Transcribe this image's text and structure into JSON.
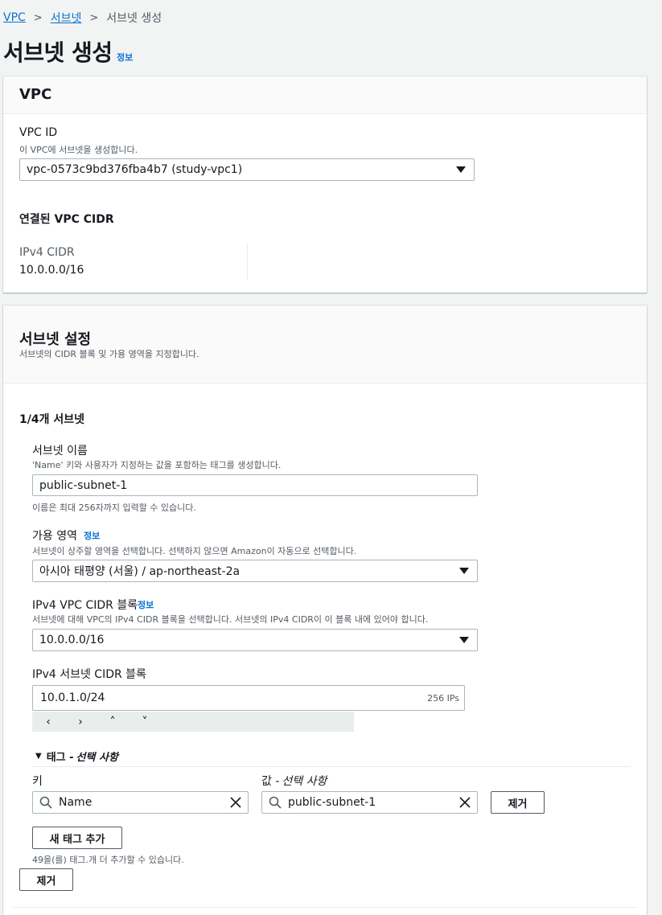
{
  "breadcrumb": {
    "vpc": "VPC",
    "subnet": "서브넷",
    "current": "서브넷 생성"
  },
  "page": {
    "title": "서브넷 생성",
    "info": "정보"
  },
  "vpc_panel": {
    "heading": "VPC",
    "vpc_id_label": "VPC ID",
    "vpc_id_desc": "이 VPC에 서브넷을 생성합니다.",
    "vpc_id_value": "vpc-0573c9bd376fba4b7 (study-vpc1)",
    "cidr_heading": "연결된 VPC CIDR",
    "ipv4_cidr_label": "IPv4 CIDR",
    "ipv4_cidr_value": "10.0.0.0/16"
  },
  "subnet_panel": {
    "heading": "서브넷 설정",
    "desc": "서브넷의 CIDR 블록 및 가용 영역을 지정합니다.",
    "count": "1/4개 서브넷",
    "name_label": "서브넷 이름",
    "name_desc": "'Name' 키와 사용자가 지정하는 값을 포함하는 태그를 생성합니다.",
    "name_value": "public-subnet-1",
    "name_hint": "이름은 최대 256자까지 입력할 수 있습니다.",
    "az_label": "가용 영역",
    "az_info": "정보",
    "az_desc": "서브넷이 상주할 영역을 선택합니다. 선택하지 않으면 Amazon이 자동으로 선택합니다.",
    "az_value": "아시아 태평양 (서울) / ap-northeast-2a",
    "vpc_cidr_label": "IPv4 VPC CIDR 블록",
    "vpc_cidr_info": "정보",
    "vpc_cidr_desc": "서브넷에 대해 VPC의 IPv4 CIDR 블록을 선택합니다. 서브넷의 IPv4 CIDR이 이 블록 내에 있어야 합니다.",
    "vpc_cidr_value": "10.0.0.0/16",
    "subnet_cidr_label": "IPv4 서브넷 CIDR 블록",
    "subnet_cidr_value": "10.0.1.0/24",
    "subnet_cidr_ips": "256 IPs",
    "nav_arrows": [
      "‹",
      "›",
      "˄",
      "˅"
    ],
    "tags_toggle": "태그 - ",
    "tags_toggle_optional": "선택 사항",
    "key_label": "키",
    "value_label": "값 - ",
    "value_label_optional": "선택 사항",
    "tag_key": "Name",
    "tag_value": "public-subnet-1",
    "remove_tag": "제거",
    "add_tag": "새 태그 추가",
    "tag_limit": "49을(를) 태그.개 더 추가할 수 있습니다.",
    "remove_subnet": "제거"
  }
}
